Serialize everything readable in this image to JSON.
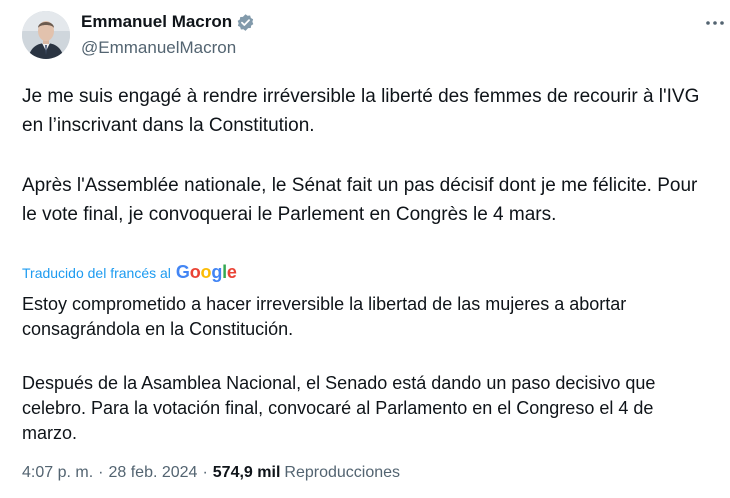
{
  "author": {
    "name": "Emmanuel Macron",
    "handle": "@EmmanuelMacron",
    "verified": true
  },
  "icons": {
    "verified": "verified-badge-icon",
    "more": "more-options-icon"
  },
  "tweet": {
    "original_paragraphs": [
      "Je me suis engagé à rendre irréversible la liberté des femmes de recourir à l'IVG en l’inscrivant dans la Constitution.",
      "Après l'Assemblée nationale, le Sénat fait un pas décisif dont je me félicite. Pour le vote final, je convoquerai le Parlement en Congrès le 4 mars."
    ],
    "translation_label": "Traducido del francés al",
    "translation_provider": "Google",
    "translated_paragraphs": [
      "Estoy comprometido a hacer irreversible la libertad de las mujeres a abortar consagrándola en la Constitución.",
      "Después de la Asamblea Nacional, el Senado está dando un paso decisivo que celebro. Para la votación final, convocaré al Parlamento en el Congreso el 4 de marzo."
    ]
  },
  "meta": {
    "time": "4:07 p. m.",
    "separator": "·",
    "date": "28 feb. 2024",
    "views_count": "574,9 mil",
    "views_label": "Reproducciones"
  },
  "colors": {
    "text": "#0f1419",
    "secondary": "#536471",
    "link": "#1d9bf0",
    "verified": "#829aab"
  }
}
